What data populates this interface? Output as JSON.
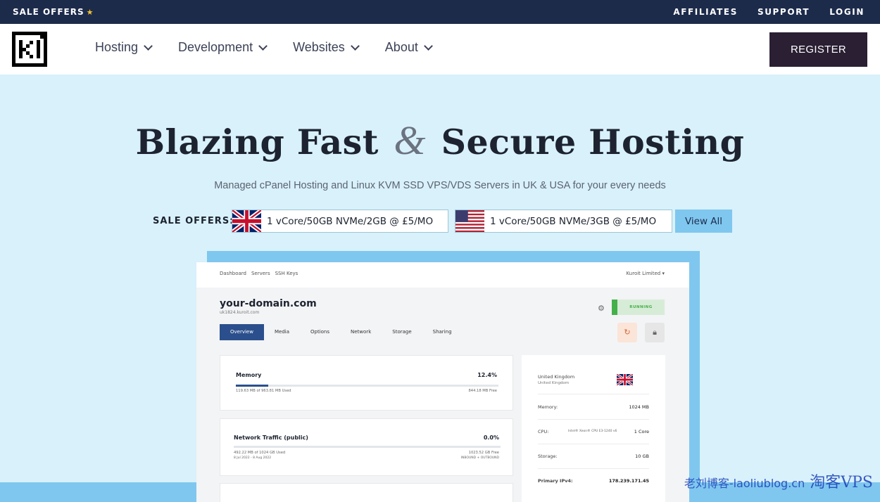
{
  "topbar": {
    "sale_offers": "SALE OFFERS",
    "links": [
      "AFFILIATES",
      "SUPPORT",
      "LOGIN"
    ]
  },
  "nav": {
    "items": [
      "Hosting",
      "Development",
      "Websites",
      "About"
    ],
    "register": "REGISTER"
  },
  "hero": {
    "title_part1": "Blazing Fast",
    "title_amp": "&",
    "title_part2": "Secure Hosting",
    "subtitle": "Managed cPanel Hosting and Linux KVM SSD VPS/VDS Servers in UK & USA for your every needs"
  },
  "offers": {
    "label": "SALE OFFERS:",
    "uk": "1 vCore/50GB NVMe/2GB @ £5/MO",
    "us": "1 vCore/50GB NVMe/3GB @ £5/MO",
    "view_all": "View All"
  },
  "mockup": {
    "crumbs": [
      "Dashboard",
      "Servers",
      "SSH Keys"
    ],
    "account": "Kuroit Limited ▾",
    "domain": "your-domain.com",
    "subdomain": "uk1824.kuroit.com",
    "status": "RUNNING",
    "tabs": [
      "Overview",
      "Media",
      "Options",
      "Network",
      "Storage",
      "Sharing"
    ],
    "memory": {
      "title": "Memory",
      "percent": "12.4%",
      "fraction": 0.124,
      "used": "119.63 MB of 963.81 MB Used",
      "free": "844.18 MB Free"
    },
    "network": {
      "title": "Network Traffic (public)",
      "percent": "0.0%",
      "fraction": 0.0,
      "used": "492.22 MB of 1024 GB Used",
      "free": "1023.52 GB Free",
      "period": "8 Jul 2022 - 8 Aug 2022",
      "direction": "INBOUND + OUTBOUND"
    },
    "info": {
      "location": "United Kingdom",
      "location_sub": "United Kingdom",
      "memory_label": "Memory:",
      "memory_value": "1024 MB",
      "cpu_label": "CPU:",
      "cpu_model": "Intel® Xeon® CPU E3-1240 v6",
      "cpu_value": "1 Core",
      "storage_label": "Storage:",
      "storage_value": "10 GB",
      "ipv4_label": "Primary IPv4:",
      "ipv4_value": "178.239.171.45"
    }
  },
  "watermark": {
    "text": "老刘博客-laoliublog.cn",
    "overlay": "淘客VPS"
  }
}
